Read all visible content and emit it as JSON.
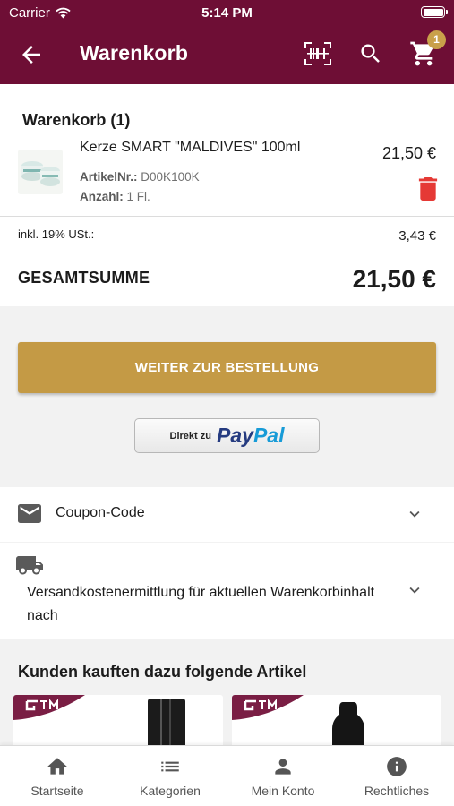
{
  "status_bar": {
    "carrier": "Carrier",
    "time": "5:14 PM"
  },
  "header": {
    "title": "Warenkorb",
    "cart_badge": "1",
    "icons": [
      "back-arrow-icon",
      "barcode-scanner-icon",
      "search-icon",
      "cart-icon"
    ]
  },
  "cart": {
    "heading": "Warenkorb (1)",
    "items": [
      {
        "name": "Kerze SMART \"MALDIVES\" 100ml",
        "price": "21,50 €",
        "article_label": "ArtikelNr.:",
        "article_no": "D00K100K",
        "quantity_label": "Anzahl:",
        "quantity": "1 Fl."
      }
    ],
    "vat_label": "inkl. 19% USt.:",
    "vat_value": "3,43 €",
    "total_label": "GESAMTSUMME",
    "total_value": "21,50 €"
  },
  "checkout": {
    "button_label": "WEITER ZUR BESTELLUNG",
    "paypal_prefix": "Direkt zu",
    "paypal_pay": "Pay",
    "paypal_pal": "Pal"
  },
  "coupon": {
    "label": "Coupon-Code"
  },
  "shipping": {
    "label": "Versandkostenermittlung für aktuellen Warenkorbinhalt nach"
  },
  "recommendations": {
    "title": "Kunden kauften dazu folgende Artikel"
  },
  "bottom_nav": [
    {
      "label": "Startseite",
      "icon": "home-icon"
    },
    {
      "label": "Kategorien",
      "icon": "list-icon"
    },
    {
      "label": "Mein Konto",
      "icon": "person-icon"
    },
    {
      "label": "Rechtliches",
      "icon": "info-icon"
    }
  ],
  "colors": {
    "header": "#6e0e35",
    "accent": "#c49a45",
    "delete": "#e53935",
    "badge": "#c9a04a"
  }
}
